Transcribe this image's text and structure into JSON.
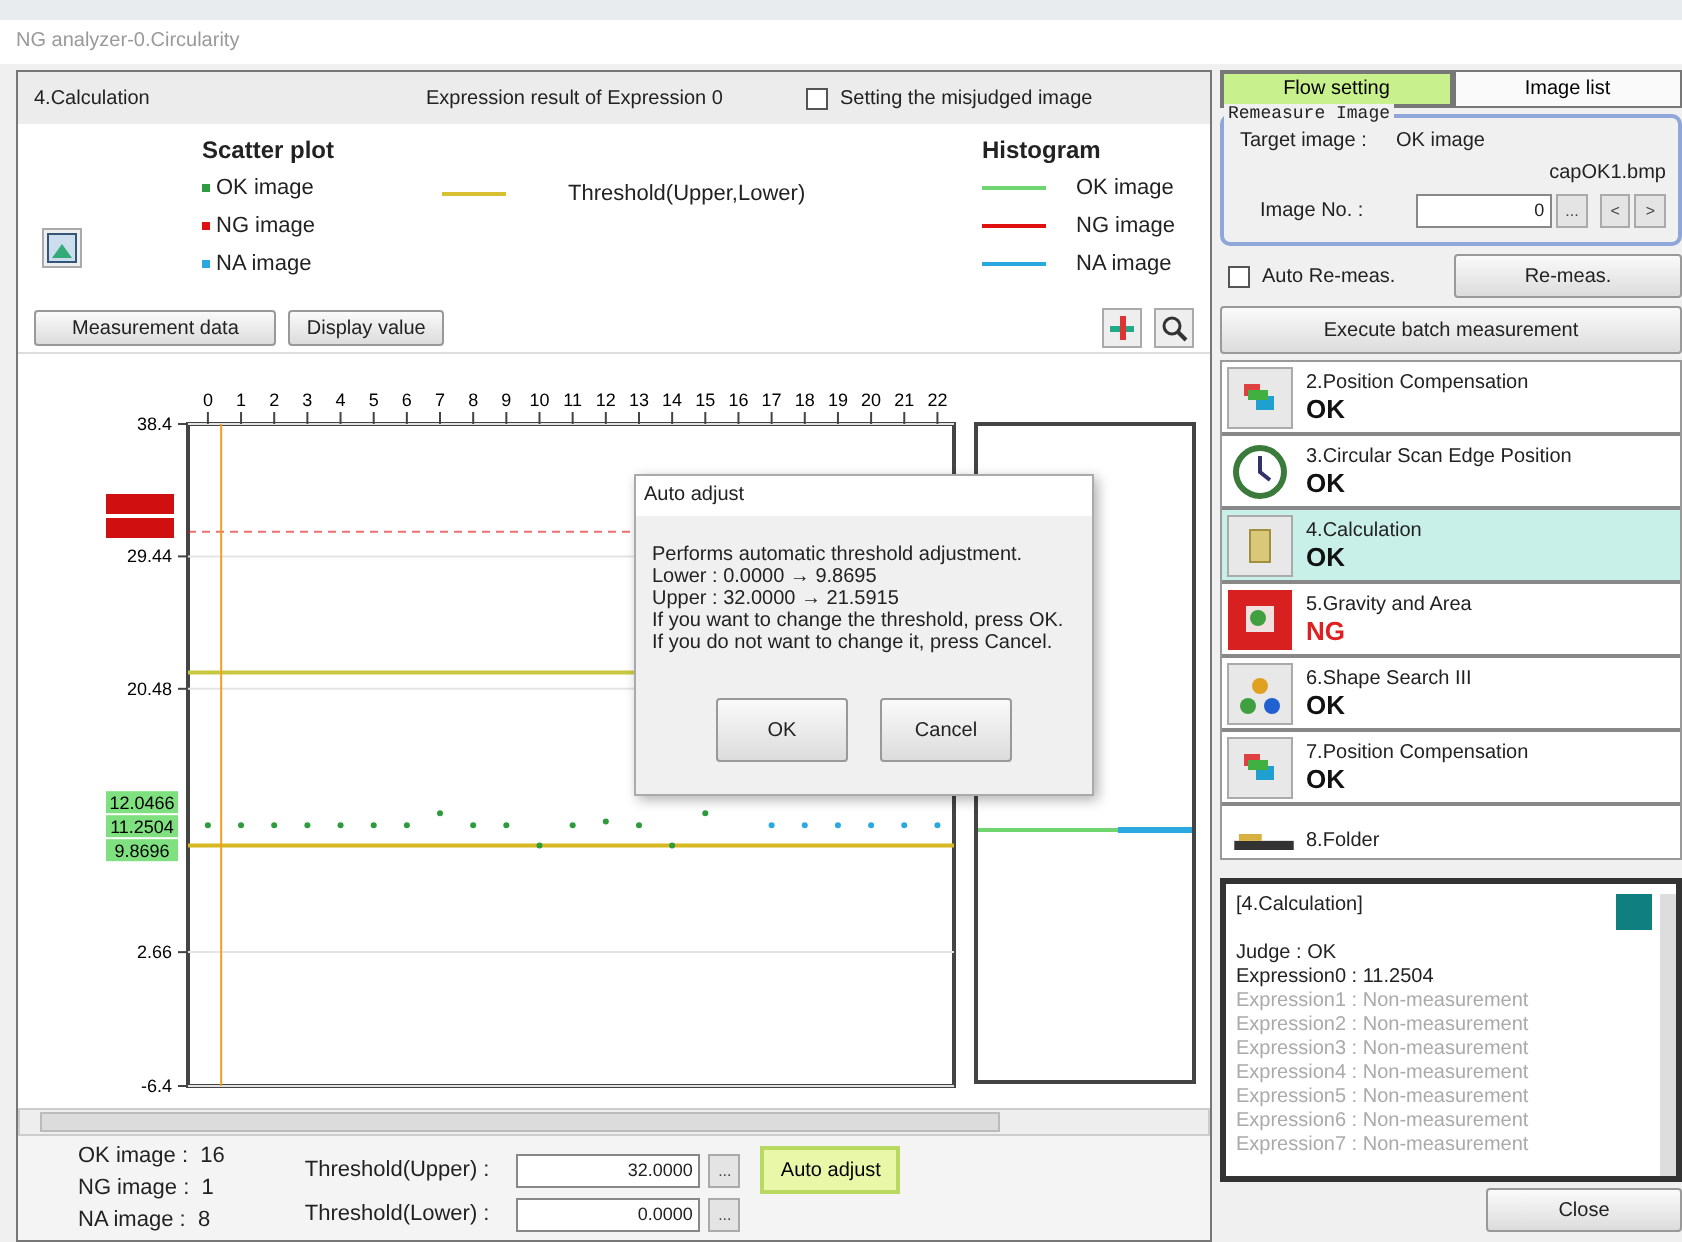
{
  "window": {
    "title": "NG analyzer-0.Circularity"
  },
  "header": {
    "unit": "4.Calculation",
    "expression": "Expression result of Expression 0",
    "misjudged": {
      "label": "Setting the misjudged image",
      "checked": false
    }
  },
  "legend": {
    "scatter_title": "Scatter plot",
    "threshold": {
      "label": "Threshold(Upper,Lower)",
      "color": "#d8c030"
    },
    "histogram_title": "Histogram",
    "histogram_items": [
      {
        "label": "OK image",
        "color": "#6fd66f"
      },
      {
        "label": "NG image",
        "color": "#e01010"
      },
      {
        "label": "NA image",
        "color": "#29a9e0"
      }
    ]
  },
  "buttons": [
    "Measurement data",
    "Display value"
  ],
  "chart": {
    "chart_data": {
      "type": "scatter",
      "x": [
        0,
        1,
        2,
        3,
        4,
        5,
        6,
        7,
        8,
        9,
        10,
        11,
        12,
        13,
        14,
        15,
        16,
        17,
        18,
        19,
        20,
        21,
        22
      ],
      "series": [
        {
          "name": "OK image",
          "color": "#2e9b3e",
          "values": [
            11.25,
            11.25,
            11.25,
            11.25,
            11.25,
            11.25,
            11.25,
            12.05,
            11.25,
            11.25,
            9.87,
            11.25,
            11.5,
            11.25,
            9.87,
            12.05,
            null,
            null,
            null,
            null,
            null,
            null,
            null
          ]
        },
        {
          "name": "NG image",
          "color": "#e01010",
          "values": [
            null,
            null,
            null,
            null,
            null,
            null,
            null,
            null,
            null,
            null,
            null,
            null,
            null,
            null,
            null,
            null,
            null,
            null,
            null,
            null,
            null,
            null,
            null
          ]
        },
        {
          "name": "NA image",
          "color": "#29a9e0",
          "values": [
            null,
            null,
            null,
            null,
            null,
            null,
            null,
            null,
            null,
            null,
            null,
            null,
            null,
            null,
            null,
            null,
            null,
            11.25,
            11.25,
            11.25,
            11.25,
            11.25,
            11.25
          ]
        }
      ],
      "xlim": [
        -0.6,
        22.5
      ],
      "ylim": [
        -6.4,
        38.4
      ],
      "xticks": [
        0,
        1,
        2,
        3,
        4,
        5,
        6,
        7,
        8,
        9,
        10,
        11,
        12,
        13,
        14,
        15,
        16,
        17,
        18,
        19,
        20,
        21,
        22
      ],
      "yticks": [
        38.4,
        29.44,
        20.48,
        2.66,
        -6.4
      ],
      "grid": true,
      "ref_lines": [
        {
          "axis": "y",
          "value": 31.1,
          "color": "#e01010"
        },
        {
          "axis": "y",
          "value": 21.5915,
          "color": "#c8c840"
        },
        {
          "axis": "y",
          "value": 9.8695,
          "color": "#d8b820"
        },
        {
          "axis": "x",
          "value": 0.4,
          "color": "#f0a020"
        }
      ],
      "annotations": [
        {
          "text": "12.0466"
        },
        {
          "text": "11.2504"
        },
        {
          "text": "9.8696"
        }
      ]
    }
  },
  "dialog": {
    "title": "Auto adjust",
    "lines": [
      "Performs automatic threshold adjustment.",
      "Lower : 0.0000 → 9.8695",
      "Upper : 32.0000 → 21.5915",
      "If you want to change the threshold, press OK.",
      "If you do not want to change it, press Cancel."
    ],
    "buttons": [
      "OK",
      "Cancel"
    ]
  },
  "counts": [
    {
      "label": "OK image :",
      "value": "16"
    },
    {
      "label": "NG image :",
      "value": "1"
    },
    {
      "label": "NA image :",
      "value": "8"
    }
  ],
  "thresholds": [
    {
      "label": "Threshold(Upper) :",
      "value": "32.0000",
      "browse": "..."
    },
    {
      "label": "Threshold(Lower) :",
      "value": "0.0000",
      "browse": "..."
    }
  ],
  "auto_adjust": "Auto adjust",
  "side": {
    "tabs": [
      {
        "label": "Flow setting",
        "selected": true
      },
      {
        "label": "Image list",
        "selected": false
      }
    ],
    "remeasure": {
      "title": "Remeasure Image",
      "target_label": "Target image :",
      "target_value": "OK image",
      "file": "capOK1.bmp",
      "image_no_label": "Image No. :",
      "image_no": "0",
      "browse": "...",
      "prev": "<",
      "next": ">"
    },
    "auto_remeas": {
      "label": "Auto Re-meas.",
      "checked": false
    },
    "remeas": "Re-meas.",
    "batch": "Execute batch measurement",
    "flow": [
      {
        "name": "2.Position Compensation",
        "judge": "OK",
        "kind": "position",
        "selected": false
      },
      {
        "name": "3.Circular Scan Edge Position",
        "judge": "OK",
        "kind": "circle",
        "selected": false
      },
      {
        "name": "4.Calculation",
        "judge": "OK",
        "kind": "calc",
        "selected": true
      },
      {
        "name": "5.Gravity and Area",
        "judge": "NG",
        "kind": "gravity",
        "selected": false
      },
      {
        "name": "6.Shape Search III",
        "judge": "OK",
        "kind": "shape",
        "selected": false
      },
      {
        "name": "7.Position Compensation",
        "judge": "OK",
        "kind": "position",
        "selected": false
      },
      {
        "name": "8.Folder",
        "kind": "folder",
        "selected": false
      }
    ],
    "detail": {
      "title": "[4.Calculation]",
      "color": "#0f7f7f",
      "lines": [
        {
          "text": "Judge : OK",
          "measured": true
        },
        {
          "text": "Expression0 : 11.2504",
          "measured": true
        },
        {
          "text": "Expression1 : Non-measurement",
          "measured": false
        },
        {
          "text": "Expression2 : Non-measurement",
          "measured": false
        },
        {
          "text": "Expression3 : Non-measurement",
          "measured": false
        },
        {
          "text": "Expression4 : Non-measurement",
          "measured": false
        },
        {
          "text": "Expression5 : Non-measurement",
          "measured": false
        },
        {
          "text": "Expression6 : Non-measurement",
          "measured": false
        },
        {
          "text": "Expression7 : Non-measurement",
          "measured": false
        }
      ]
    },
    "close": "Close"
  }
}
